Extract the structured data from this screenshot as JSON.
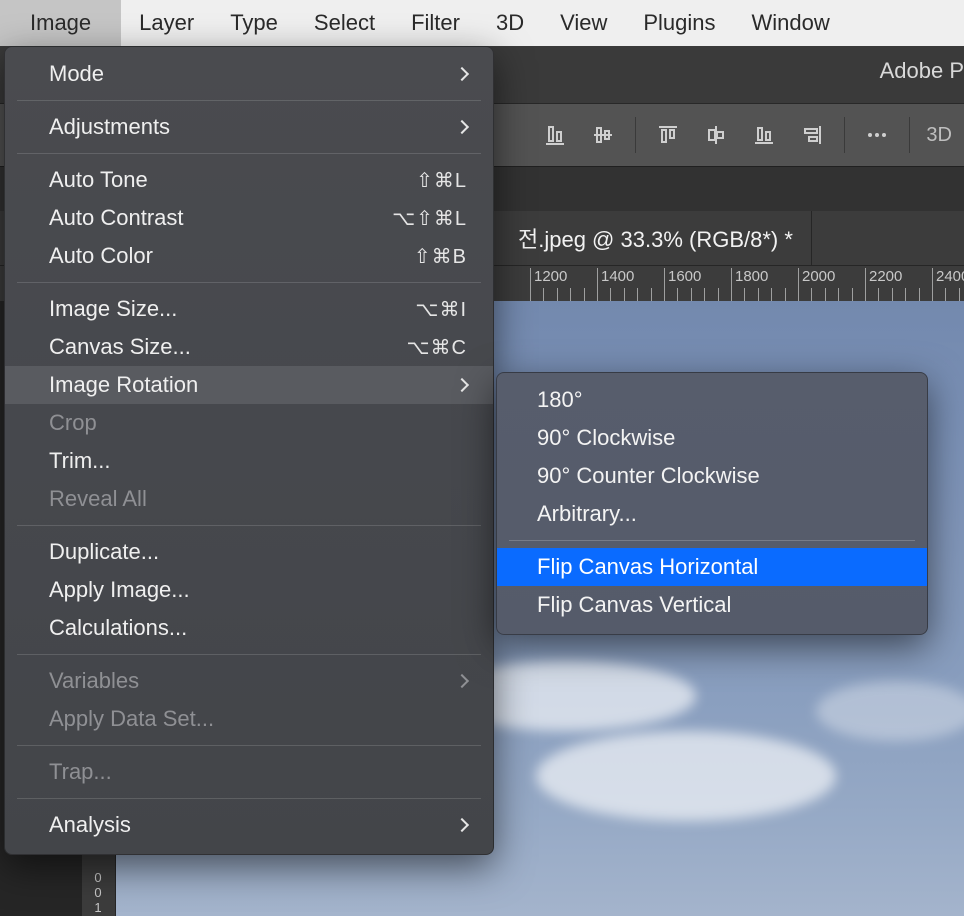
{
  "menubar": {
    "items": [
      "Image",
      "Layer",
      "Type",
      "Select",
      "Filter",
      "3D",
      "View",
      "Plugins",
      "Window"
    ],
    "active_index": 0
  },
  "app_title": "Adobe P",
  "options_bar": {
    "threeD_label": "3D "
  },
  "tab": {
    "title": "전.jpeg @ 33.3% (RGB/8*) *"
  },
  "ruler": {
    "labels": [
      "1200",
      "1400",
      "1600",
      "1800",
      "2000",
      "2200",
      "2400"
    ],
    "v_labels": [
      "0",
      "0",
      "1"
    ]
  },
  "image_menu": {
    "groups": [
      [
        {
          "label": "Mode",
          "submenu": true
        }
      ],
      [
        {
          "label": "Adjustments",
          "submenu": true
        }
      ],
      [
        {
          "label": "Auto Tone",
          "shortcut": "⇧⌘L"
        },
        {
          "label": "Auto Contrast",
          "shortcut": "⌥⇧⌘L"
        },
        {
          "label": "Auto Color",
          "shortcut": "⇧⌘B"
        }
      ],
      [
        {
          "label": "Image Size...",
          "shortcut": "⌥⌘I"
        },
        {
          "label": "Canvas Size...",
          "shortcut": "⌥⌘C"
        },
        {
          "label": "Image Rotation",
          "submenu": true,
          "hovered": true
        },
        {
          "label": "Crop",
          "disabled": true
        },
        {
          "label": "Trim..."
        },
        {
          "label": "Reveal All",
          "disabled": true
        }
      ],
      [
        {
          "label": "Duplicate..."
        },
        {
          "label": "Apply Image..."
        },
        {
          "label": "Calculations..."
        }
      ],
      [
        {
          "label": "Variables",
          "submenu": true,
          "disabled": true
        },
        {
          "label": "Apply Data Set...",
          "disabled": true
        }
      ],
      [
        {
          "label": "Trap...",
          "disabled": true
        }
      ],
      [
        {
          "label": "Analysis",
          "submenu": true
        }
      ]
    ]
  },
  "rotation_submenu": {
    "groups": [
      [
        {
          "label": "180°"
        },
        {
          "label": "90° Clockwise"
        },
        {
          "label": "90° Counter Clockwise"
        },
        {
          "label": "Arbitrary..."
        }
      ],
      [
        {
          "label": "Flip Canvas Horizontal",
          "highlight": true
        },
        {
          "label": "Flip Canvas Vertical"
        }
      ]
    ]
  }
}
